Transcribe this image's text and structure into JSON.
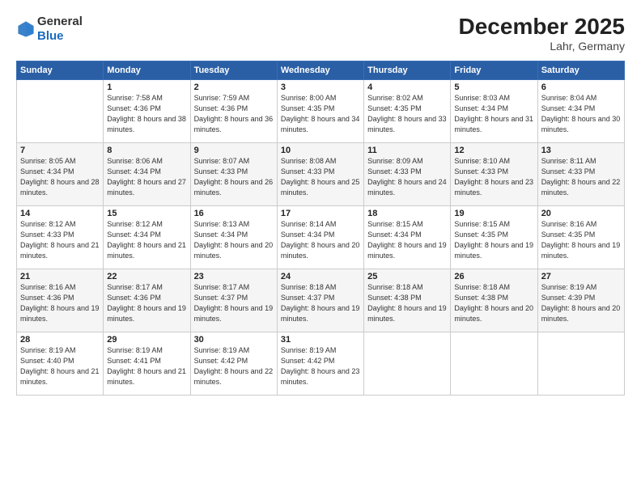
{
  "logo": {
    "general": "General",
    "blue": "Blue"
  },
  "title": "December 2025",
  "subtitle": "Lahr, Germany",
  "days_header": [
    "Sunday",
    "Monday",
    "Tuesday",
    "Wednesday",
    "Thursday",
    "Friday",
    "Saturday"
  ],
  "weeks": [
    [
      {
        "day": "",
        "sunrise": "",
        "sunset": "",
        "daylight": ""
      },
      {
        "day": "1",
        "sunrise": "7:58 AM",
        "sunset": "4:36 PM",
        "daylight": "8 hours and 38 minutes."
      },
      {
        "day": "2",
        "sunrise": "7:59 AM",
        "sunset": "4:36 PM",
        "daylight": "8 hours and 36 minutes."
      },
      {
        "day": "3",
        "sunrise": "8:00 AM",
        "sunset": "4:35 PM",
        "daylight": "8 hours and 34 minutes."
      },
      {
        "day": "4",
        "sunrise": "8:02 AM",
        "sunset": "4:35 PM",
        "daylight": "8 hours and 33 minutes."
      },
      {
        "day": "5",
        "sunrise": "8:03 AM",
        "sunset": "4:34 PM",
        "daylight": "8 hours and 31 minutes."
      },
      {
        "day": "6",
        "sunrise": "8:04 AM",
        "sunset": "4:34 PM",
        "daylight": "8 hours and 30 minutes."
      }
    ],
    [
      {
        "day": "7",
        "sunrise": "8:05 AM",
        "sunset": "4:34 PM",
        "daylight": "8 hours and 28 minutes."
      },
      {
        "day": "8",
        "sunrise": "8:06 AM",
        "sunset": "4:34 PM",
        "daylight": "8 hours and 27 minutes."
      },
      {
        "day": "9",
        "sunrise": "8:07 AM",
        "sunset": "4:33 PM",
        "daylight": "8 hours and 26 minutes."
      },
      {
        "day": "10",
        "sunrise": "8:08 AM",
        "sunset": "4:33 PM",
        "daylight": "8 hours and 25 minutes."
      },
      {
        "day": "11",
        "sunrise": "8:09 AM",
        "sunset": "4:33 PM",
        "daylight": "8 hours and 24 minutes."
      },
      {
        "day": "12",
        "sunrise": "8:10 AM",
        "sunset": "4:33 PM",
        "daylight": "8 hours and 23 minutes."
      },
      {
        "day": "13",
        "sunrise": "8:11 AM",
        "sunset": "4:33 PM",
        "daylight": "8 hours and 22 minutes."
      }
    ],
    [
      {
        "day": "14",
        "sunrise": "8:12 AM",
        "sunset": "4:33 PM",
        "daylight": "8 hours and 21 minutes."
      },
      {
        "day": "15",
        "sunrise": "8:12 AM",
        "sunset": "4:34 PM",
        "daylight": "8 hours and 21 minutes."
      },
      {
        "day": "16",
        "sunrise": "8:13 AM",
        "sunset": "4:34 PM",
        "daylight": "8 hours and 20 minutes."
      },
      {
        "day": "17",
        "sunrise": "8:14 AM",
        "sunset": "4:34 PM",
        "daylight": "8 hours and 20 minutes."
      },
      {
        "day": "18",
        "sunrise": "8:15 AM",
        "sunset": "4:34 PM",
        "daylight": "8 hours and 19 minutes."
      },
      {
        "day": "19",
        "sunrise": "8:15 AM",
        "sunset": "4:35 PM",
        "daylight": "8 hours and 19 minutes."
      },
      {
        "day": "20",
        "sunrise": "8:16 AM",
        "sunset": "4:35 PM",
        "daylight": "8 hours and 19 minutes."
      }
    ],
    [
      {
        "day": "21",
        "sunrise": "8:16 AM",
        "sunset": "4:36 PM",
        "daylight": "8 hours and 19 minutes."
      },
      {
        "day": "22",
        "sunrise": "8:17 AM",
        "sunset": "4:36 PM",
        "daylight": "8 hours and 19 minutes."
      },
      {
        "day": "23",
        "sunrise": "8:17 AM",
        "sunset": "4:37 PM",
        "daylight": "8 hours and 19 minutes."
      },
      {
        "day": "24",
        "sunrise": "8:18 AM",
        "sunset": "4:37 PM",
        "daylight": "8 hours and 19 minutes."
      },
      {
        "day": "25",
        "sunrise": "8:18 AM",
        "sunset": "4:38 PM",
        "daylight": "8 hours and 19 minutes."
      },
      {
        "day": "26",
        "sunrise": "8:18 AM",
        "sunset": "4:38 PM",
        "daylight": "8 hours and 20 minutes."
      },
      {
        "day": "27",
        "sunrise": "8:19 AM",
        "sunset": "4:39 PM",
        "daylight": "8 hours and 20 minutes."
      }
    ],
    [
      {
        "day": "28",
        "sunrise": "8:19 AM",
        "sunset": "4:40 PM",
        "daylight": "8 hours and 21 minutes."
      },
      {
        "day": "29",
        "sunrise": "8:19 AM",
        "sunset": "4:41 PM",
        "daylight": "8 hours and 21 minutes."
      },
      {
        "day": "30",
        "sunrise": "8:19 AM",
        "sunset": "4:42 PM",
        "daylight": "8 hours and 22 minutes."
      },
      {
        "day": "31",
        "sunrise": "8:19 AM",
        "sunset": "4:42 PM",
        "daylight": "8 hours and 23 minutes."
      },
      {
        "day": "",
        "sunrise": "",
        "sunset": "",
        "daylight": ""
      },
      {
        "day": "",
        "sunrise": "",
        "sunset": "",
        "daylight": ""
      },
      {
        "day": "",
        "sunrise": "",
        "sunset": "",
        "daylight": ""
      }
    ]
  ],
  "labels": {
    "sunrise_prefix": "Sunrise: ",
    "sunset_prefix": "Sunset: ",
    "daylight_prefix": "Daylight: "
  }
}
